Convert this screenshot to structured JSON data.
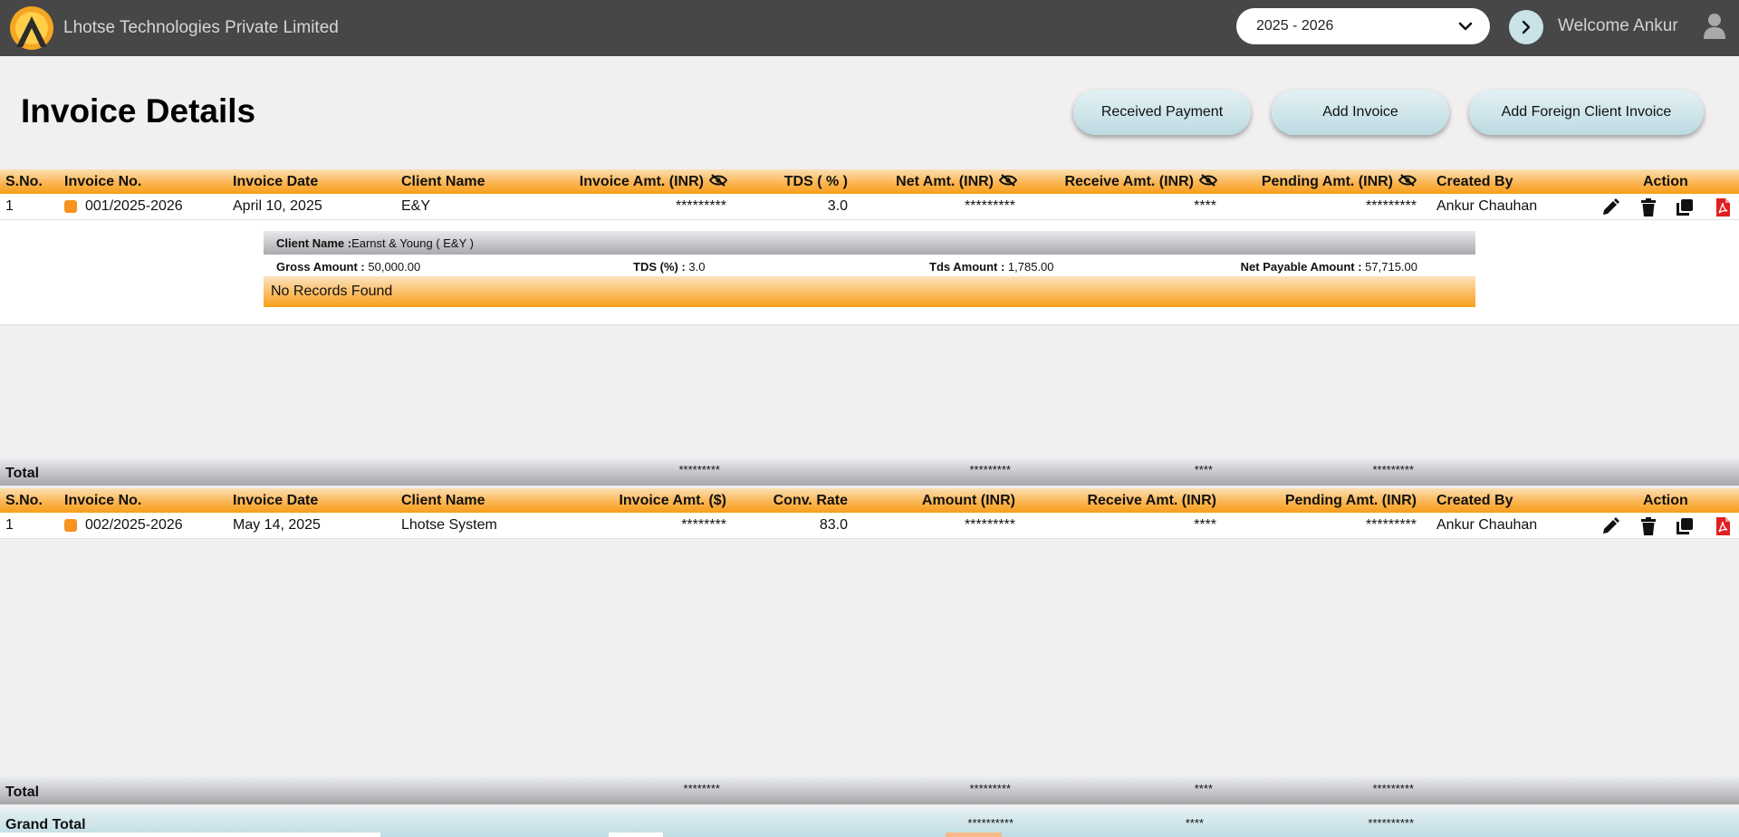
{
  "header": {
    "company": "Lhotse Technologies Private Limited",
    "financial_year": "2025 - 2026",
    "welcome": "Welcome Ankur"
  },
  "page": {
    "title": "Invoice Details",
    "buttons": {
      "received_payment": "Received Payment",
      "add_invoice": "Add Invoice",
      "add_foreign": "Add Foreign Client Invoice"
    }
  },
  "domestic_table": {
    "headers": {
      "sno": "S.No.",
      "invoice_no": "Invoice No.",
      "invoice_date": "Invoice Date",
      "client_name": "Client Name",
      "invoice_amt": "Invoice Amt. (INR)",
      "tds": "TDS ( % )",
      "net_amt": "Net Amt. (INR)",
      "receive_amt": "Receive Amt. (INR)",
      "pending_amt": "Pending Amt. (INR)",
      "created_by": "Created By",
      "action": "Action"
    },
    "rows": [
      {
        "sno": "1",
        "invoice_no": "001/2025-2026",
        "invoice_date": "April 10, 2025",
        "client_name": "E&Y",
        "invoice_amt": "*********",
        "tds": "3.0",
        "net_amt": "*********",
        "receive_amt": "****",
        "pending_amt": "*********",
        "created_by": "Ankur Chauhan"
      }
    ],
    "detail": {
      "client_label": "Client Name :",
      "client_value": "Earnst & Young ( E&Y )",
      "gross_label": "Gross Amount :",
      "gross_value": "50,000.00",
      "tds_label": "TDS (%) :",
      "tds_value": "3.0",
      "tds_amount_label": "Tds Amount :",
      "tds_amount_value": "1,785.00",
      "net_payable_label": "Net Payable Amount :",
      "net_payable_value": "57,715.00",
      "no_records": "No Records Found"
    },
    "total": {
      "label": "Total",
      "invoice_amt": "*********",
      "net_amt": "*********",
      "receive_amt": "****",
      "pending_amt": "*********"
    }
  },
  "foreign_table": {
    "headers": {
      "sno": "S.No.",
      "invoice_no": "Invoice No.",
      "invoice_date": "Invoice Date",
      "client_name": "Client Name",
      "invoice_amt": "Invoice Amt. ($)",
      "conv_rate": "Conv. Rate",
      "amount": "Amount (INR)",
      "receive_amt": "Receive Amt. (INR)",
      "pending_amt": "Pending Amt. (INR)",
      "created_by": "Created By",
      "action": "Action"
    },
    "rows": [
      {
        "sno": "1",
        "invoice_no": "002/2025-2026",
        "invoice_date": "May 14, 2025",
        "client_name": "Lhotse System",
        "invoice_amt": "********",
        "conv_rate": "83.0",
        "amount": "*********",
        "receive_amt": "****",
        "pending_amt": "*********",
        "created_by": "Ankur Chauhan"
      }
    ],
    "total": {
      "label": "Total",
      "invoice_amt": "********",
      "amount": "*********",
      "receive_amt": "****",
      "pending_amt": "*********"
    }
  },
  "grand_total": {
    "label": "Grand Total",
    "net_amt": "**********",
    "receive_amt": "****",
    "pending_amt": "**********"
  },
  "colors": {
    "topbar": "#474747",
    "accent_orange": "#f89e1a",
    "button_bg": "#c9e2e8",
    "pdf_red": "#e02020"
  },
  "icons": {
    "visibility_toggle": "eye-slash-icon",
    "edit": "pencil-icon",
    "delete": "trash-icon",
    "copy": "copy-icon",
    "pdf": "pdf-icon"
  }
}
